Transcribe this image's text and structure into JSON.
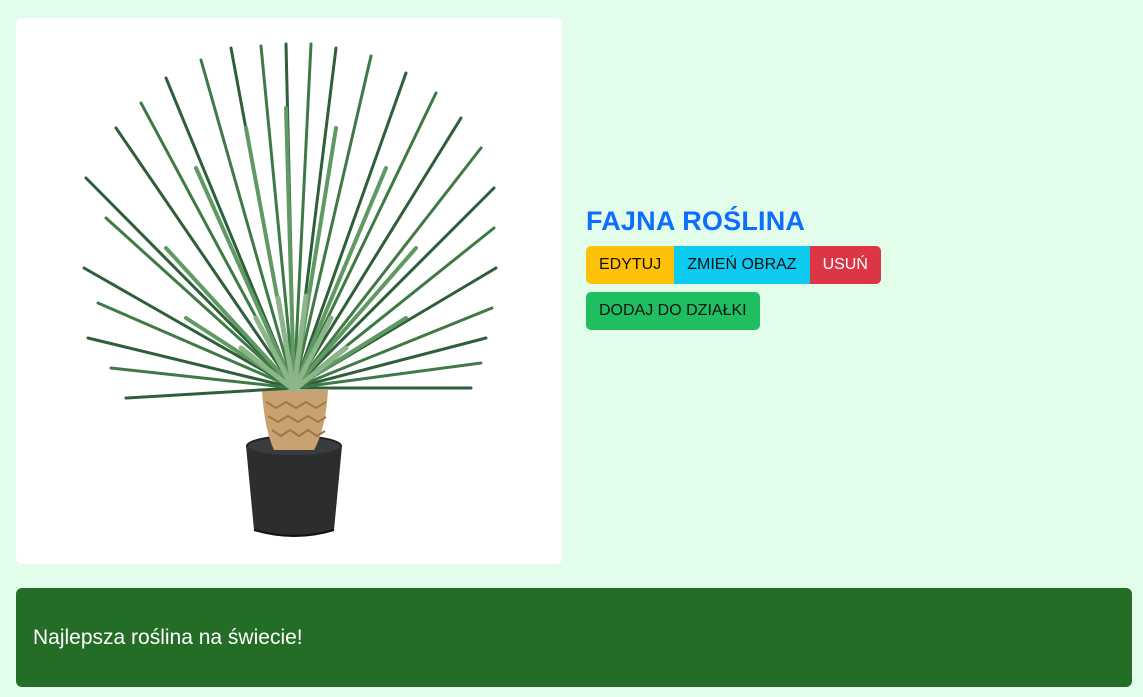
{
  "plant": {
    "name": "FAJNA ROŚLINA",
    "description": "Najlepsza roślina na świecie!",
    "image_icon": "potted-yucca-plant"
  },
  "actions": {
    "edit_label": "EDYTUJ",
    "change_image_label": "ZMIEŃ OBRAZ",
    "delete_label": "USUŃ",
    "add_to_plot_label": "DODAJ DO DZIAŁKI"
  },
  "colors": {
    "page_background": "#e2fdea",
    "title": "#0d6efd",
    "edit": "#ffc107",
    "change_image": "#0dcaf0",
    "delete": "#dc3545",
    "add": "#1fbf61",
    "description_box": "#236d27"
  }
}
